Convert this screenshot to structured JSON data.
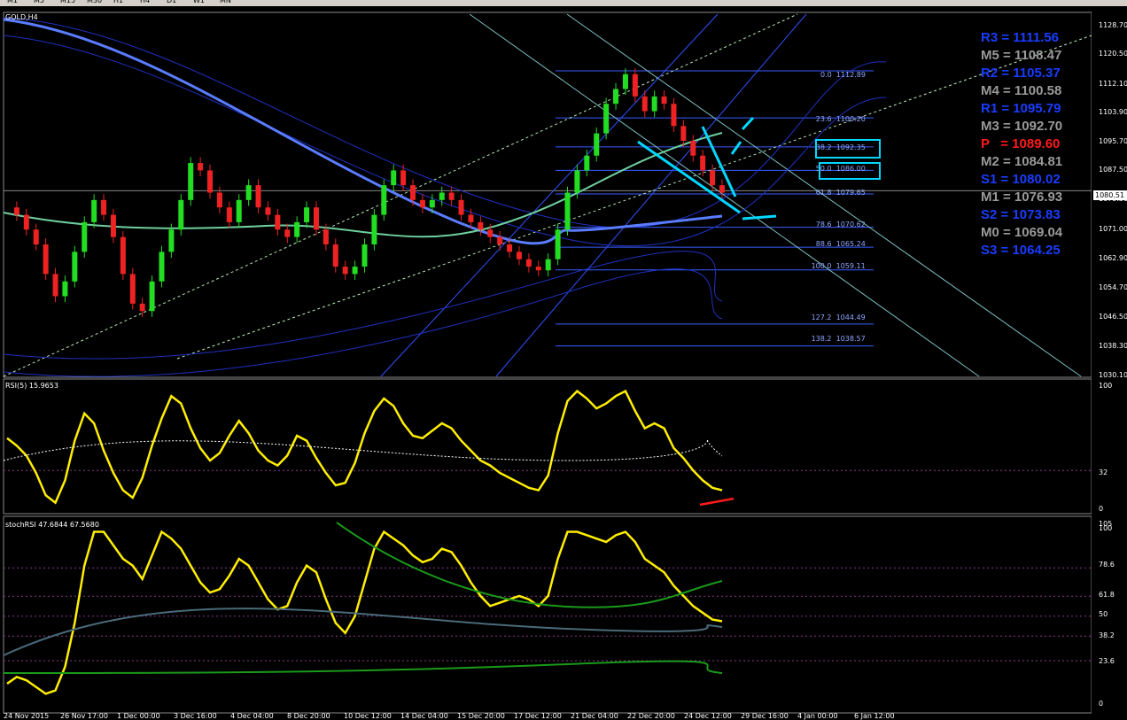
{
  "window": {
    "symbol_title": "GOLD,H4",
    "timeframes": [
      "M1",
      "M5",
      "M15",
      "M30",
      "H1",
      "H4",
      "D1",
      "W1",
      "MN"
    ]
  },
  "colors": {
    "background": "#000000",
    "bull_candle": "#22dd22",
    "bear_candle": "#ee2222",
    "rsi_line": "#ffee00",
    "annotation_cyan": "#00d8ff",
    "annotation_red": "#ff1a1a",
    "pivot_blue": "#1a3cff",
    "pivot_gray": "#9a9a9a",
    "pivot_red": "#ff1a1a"
  },
  "pivots": [
    {
      "label": "R3 = 1111.56",
      "color": "blue"
    },
    {
      "label": "M5 = 1108.47",
      "color": "gray"
    },
    {
      "label": "R2 = 1105.37",
      "color": "blue"
    },
    {
      "label": "M4 = 1100.58",
      "color": "gray"
    },
    {
      "label": "R1 = 1095.79",
      "color": "blue"
    },
    {
      "label": "M3 = 1092.70",
      "color": "gray"
    },
    {
      "label": "P   = 1089.60",
      "color": "red"
    },
    {
      "label": "M2 = 1084.81",
      "color": "gray"
    },
    {
      "label": "S1 = 1080.02",
      "color": "blue"
    },
    {
      "label": "M1 = 1076.93",
      "color": "gray"
    },
    {
      "label": "S2 = 1073.83",
      "color": "blue"
    },
    {
      "label": "M0 = 1069.04",
      "color": "gray"
    },
    {
      "label": "S3 = 1064.25",
      "color": "blue"
    }
  ],
  "fibonacci": [
    {
      "level": "0.0",
      "price": "1112.89"
    },
    {
      "level": "23.6",
      "price": "1100.20"
    },
    {
      "level": "38.2",
      "price": "1092.35"
    },
    {
      "level": "50.0",
      "price": "1086.00"
    },
    {
      "level": "61.8",
      "price": "1079.65"
    },
    {
      "level": "78.6",
      "price": "1070.62"
    },
    {
      "level": "88.6",
      "price": "1065.24"
    },
    {
      "level": "100.0",
      "price": "1059.11"
    },
    {
      "level": "127.2",
      "price": "1044.49"
    },
    {
      "level": "138.2",
      "price": "1038.57"
    }
  ],
  "price_axis": {
    "ticks": [
      "1128.70",
      "1120.50",
      "1112.10",
      "1103.90",
      "1095.70",
      "1087.50",
      "1079.30",
      "1071.00",
      "1062.90",
      "1054.70",
      "1046.50",
      "1038.30",
      "1030.10"
    ],
    "current_price": "1080.51"
  },
  "rsi_panel": {
    "title": "RSI(5) 15.9653",
    "ticks": [
      "100",
      "32",
      "0"
    ]
  },
  "stoch_panel": {
    "title": "stochRSI 47.6844 67.5680",
    "ticks": [
      "105",
      "100",
      "78.6",
      "61.8",
      "50",
      "38.2",
      "23.6",
      "0"
    ]
  },
  "date_axis": [
    "24 Nov 2015",
    "26 Nov 17:00",
    "1 Dec 00:00",
    "3 Dec 16:00",
    "4 Dec 04:00",
    "8 Dec 20:00",
    "10 Dec 12:00",
    "14 Dec 04:00",
    "15 Dec 20:00",
    "17 Dec 12:00",
    "21 Dec 04:00",
    "22 Dec 20:00",
    "24 Dec 12:00",
    "29 Dec 16:00",
    "4 Jan 00:00",
    "6 Jan 12:00"
  ],
  "chart_data": {
    "type": "line",
    "title": "GOLD,H4",
    "price_range": [
      1030.1,
      1128.7
    ],
    "series": [
      {
        "name": "GOLD,H4",
        "values": [
          1076,
          1074,
          1070,
          1066,
          1058,
          1052,
          1056,
          1064,
          1072,
          1078,
          1074,
          1068,
          1058,
          1050,
          1048,
          1056,
          1064,
          1070,
          1078,
          1088,
          1086,
          1080,
          1076,
          1072,
          1078,
          1082,
          1076,
          1074,
          1070,
          1068,
          1072,
          1076,
          1070,
          1066,
          1060,
          1058,
          1060,
          1066,
          1074,
          1082,
          1086,
          1082,
          1078,
          1076,
          1078,
          1080,
          1078,
          1074,
          1072,
          1070,
          1068,
          1066,
          1064,
          1062,
          1060,
          1059,
          1062,
          1070,
          1080,
          1086,
          1090,
          1096,
          1104,
          1108,
          1112,
          1106,
          1102,
          1106,
          1104,
          1098,
          1094,
          1090,
          1086,
          1082,
          1080
        ]
      },
      {
        "name": "RSI(5)",
        "values": [
          58,
          52,
          44,
          30,
          12,
          6,
          24,
          56,
          78,
          70,
          48,
          30,
          16,
          10,
          26,
          52,
          74,
          92,
          86,
          66,
          50,
          40,
          46,
          60,
          72,
          62,
          48,
          40,
          36,
          44,
          60,
          56,
          42,
          30,
          20,
          22,
          38,
          62,
          80,
          90,
          84,
          70,
          60,
          58,
          64,
          70,
          66,
          56,
          48,
          40,
          36,
          30,
          26,
          22,
          18,
          16,
          28,
          62,
          88,
          96,
          90,
          82,
          86,
          92,
          96,
          80,
          66,
          70,
          66,
          50,
          42,
          32,
          24,
          18,
          16
        ]
      },
      {
        "name": "stochRSI",
        "values": [
          10,
          14,
          12,
          8,
          4,
          6,
          20,
          46,
          80,
          100,
          100,
          92,
          84,
          80,
          72,
          86,
          100,
          96,
          90,
          80,
          70,
          64,
          66,
          74,
          84,
          80,
          70,
          60,
          54,
          56,
          70,
          80,
          76,
          60,
          46,
          40,
          50,
          70,
          90,
          100,
          96,
          92,
          86,
          82,
          84,
          90,
          88,
          80,
          70,
          62,
          56,
          58,
          60,
          62,
          60,
          56,
          62,
          84,
          100,
          100,
          98,
          96,
          94,
          98,
          100,
          94,
          84,
          80,
          76,
          68,
          62,
          56,
          52,
          48,
          47
        ]
      }
    ]
  }
}
